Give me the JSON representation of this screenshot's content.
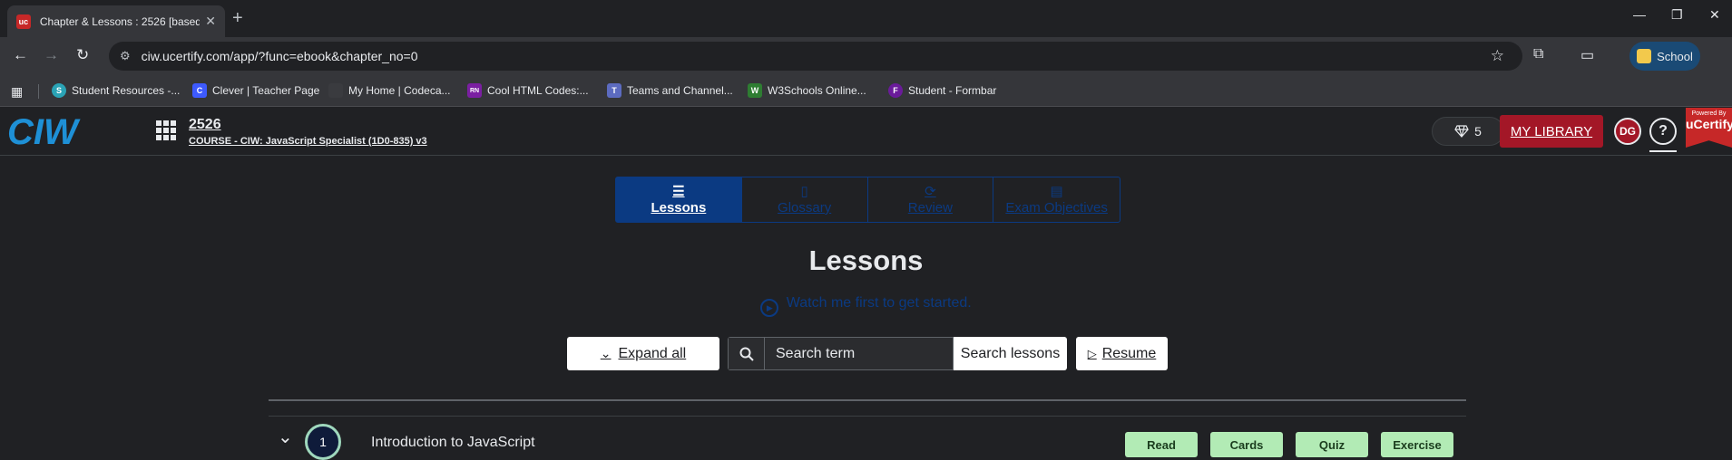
{
  "browser": {
    "tab_title": "Chapter & Lessons : 2526 [based",
    "url": "ciw.ucertify.com/app/?func=ebook&chapter_no=0",
    "profile_label": "School",
    "bookmarks": [
      {
        "label": "Student Resources -...",
        "icon": "student-resources-icon",
        "color": "#2aa3b5",
        "glyph": "S"
      },
      {
        "label": "Clever | Teacher Page",
        "icon": "clever-icon",
        "color": "#3d5afe",
        "glyph": "C"
      },
      {
        "label": "My Home | Codeca...",
        "icon": "codecademy-icon",
        "color": "#3a3b3f",
        "glyph": ""
      },
      {
        "label": "Cool HTML Codes:...",
        "icon": "html-codes-icon",
        "color": "#7b1fa2",
        "glyph": "RN"
      },
      {
        "label": "Teams and Channel...",
        "icon": "teams-icon",
        "color": "#5c6bc0",
        "glyph": "T"
      },
      {
        "label": "W3Schools Online...",
        "icon": "w3schools-icon",
        "color": "#2e7d32",
        "glyph": "W"
      },
      {
        "label": "Student - Formbar",
        "icon": "formbar-icon",
        "color": "#6a1b9a",
        "glyph": "F"
      }
    ]
  },
  "header": {
    "course_no": "2526",
    "course_name": "COURSE - CIW: JavaScript Specialist (1D0-835) v3",
    "gems": "5",
    "my_library": "MY LIBRARY",
    "avatar": "DG",
    "help": "?",
    "powered_by": "Powered By",
    "brand": "uCertify",
    "logo_text": "CIW"
  },
  "nav_tabs": [
    {
      "label": "Lessons",
      "icon": "list-icon",
      "glyph": "☰",
      "active": true
    },
    {
      "label": "Glossary",
      "icon": "book-icon",
      "glyph": "📖",
      "active": false
    },
    {
      "label": "Review",
      "icon": "review-icon",
      "glyph": "⟳",
      "active": false
    },
    {
      "label": "Exam Objectives",
      "icon": "clipboard-icon",
      "glyph": "▤",
      "active": false
    }
  ],
  "main": {
    "title": "Lessons",
    "watch_text": "Watch me first to get started.",
    "expand_all": "Expand all",
    "search_placeholder": "Search term",
    "search_button": "Search lessons",
    "resume": "Resume"
  },
  "lessons": [
    {
      "number": "1",
      "title": "Introduction to JavaScript",
      "actions": [
        "Read",
        "Cards",
        "Quiz",
        "Exercise"
      ]
    }
  ],
  "colors": {
    "accent_blue": "#0b3a82",
    "library_red": "#a31727",
    "pill_green": "#b2ebb5",
    "background": "#202124"
  }
}
